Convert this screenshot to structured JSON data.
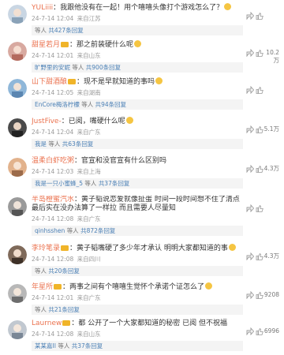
{
  "comments": [
    {
      "username": "YULiiii",
      "text": "我跟他没有在一起！用个嘻嘻头像打个游戏怎么了？",
      "time": "24-7-14 12:04",
      "location": "来自江苏",
      "replier": "",
      "reply_mid": "等人",
      "reply_count": "共427条回复",
      "likes": "",
      "avatar_color": "#c9d6e3"
    },
    {
      "username": "甜星若月",
      "text": "那之前装硬什么呢",
      "time": "24-7-14 12:01",
      "location": "来自山东",
      "replier": "旷野里的安妮",
      "reply_mid": "等人",
      "reply_count": "共900条回复",
      "likes": "10.2万",
      "avatar_color": "#d8a9a0"
    },
    {
      "username": "山下甜酒酿",
      "text": "现不是早就知道的事吗",
      "time": "24-7-14 12:05",
      "location": "来自湖南",
      "replier": "EnCore梅洛柠檬",
      "reply_mid": "等人",
      "reply_count": "共94条回复",
      "likes": "",
      "avatar_color": "#8fb7d9"
    },
    {
      "username": "JustFive-",
      "text": "已阅，嘴硬什么呢",
      "time": "24-7-14 12:04",
      "location": "来自广东",
      "replier": "我是",
      "reply_mid": "等人",
      "reply_count": "共63条回复",
      "likes": "5.1万",
      "avatar_color": "#4a4a4a"
    },
    {
      "username": "温柔白虾吃粥",
      "text": "官宣和没官宣有什么区别吗",
      "time": "24-7-14 12:03",
      "location": "来自上海",
      "replier": "我是一只小蜜蜂_5",
      "reply_mid": "等人",
      "reply_count": "共37条回复",
      "likes": "4.3万",
      "avatar_color": "#e2b28c"
    },
    {
      "username": "半岛橙蜜汽水",
      "text": "黄子韬说恋爱就像扯蛋 时间一段时间想不住了清点 最后实在没办法算了一样拉 而且需要人尽量知",
      "time": "24-7-14 12:08",
      "location": "来自广东",
      "replier": "qinhsshen",
      "reply_mid": "等人",
      "reply_count": "共872条回复",
      "likes": "",
      "avatar_color": "#9a9a9a"
    },
    {
      "username": "李玲笔录",
      "text": "黄子韬嘴硬了多少年才承认 明明大家都知道的事",
      "time": "24-7-14 12:08",
      "location": "来自四川",
      "replier": "",
      "reply_mid": "等人",
      "reply_count": "共20条回复",
      "likes": "4.3万",
      "avatar_color": "#7f6a5a"
    },
    {
      "username": "年星所",
      "text": "两事之间有个嘻嘻生觉怀个承诺个证怎么了",
      "time": "24-7-14 12:01",
      "location": "来自广东",
      "replier": "",
      "reply_mid": "等人",
      "reply_count": "共21条回复",
      "likes": "9208",
      "avatar_color": "#b8b8b8"
    },
    {
      "username": "Laurnew",
      "text": "都 公开了一个大家都知道的秘密 已阅 但不祝福",
      "time": "24-7-14 12:08",
      "location": "来自山东",
      "replier": "某某嘉II",
      "reply_mid": "等人",
      "reply_count": "共37条回复",
      "likes": "6996",
      "avatar_color": "#c1c8d0"
    }
  ],
  "icons": {
    "share": "share-icon",
    "like": "thumbs-up-icon"
  },
  "colors": {
    "username": "#eb7350",
    "reply_link": "#4a7fb5",
    "meta": "#999999"
  }
}
